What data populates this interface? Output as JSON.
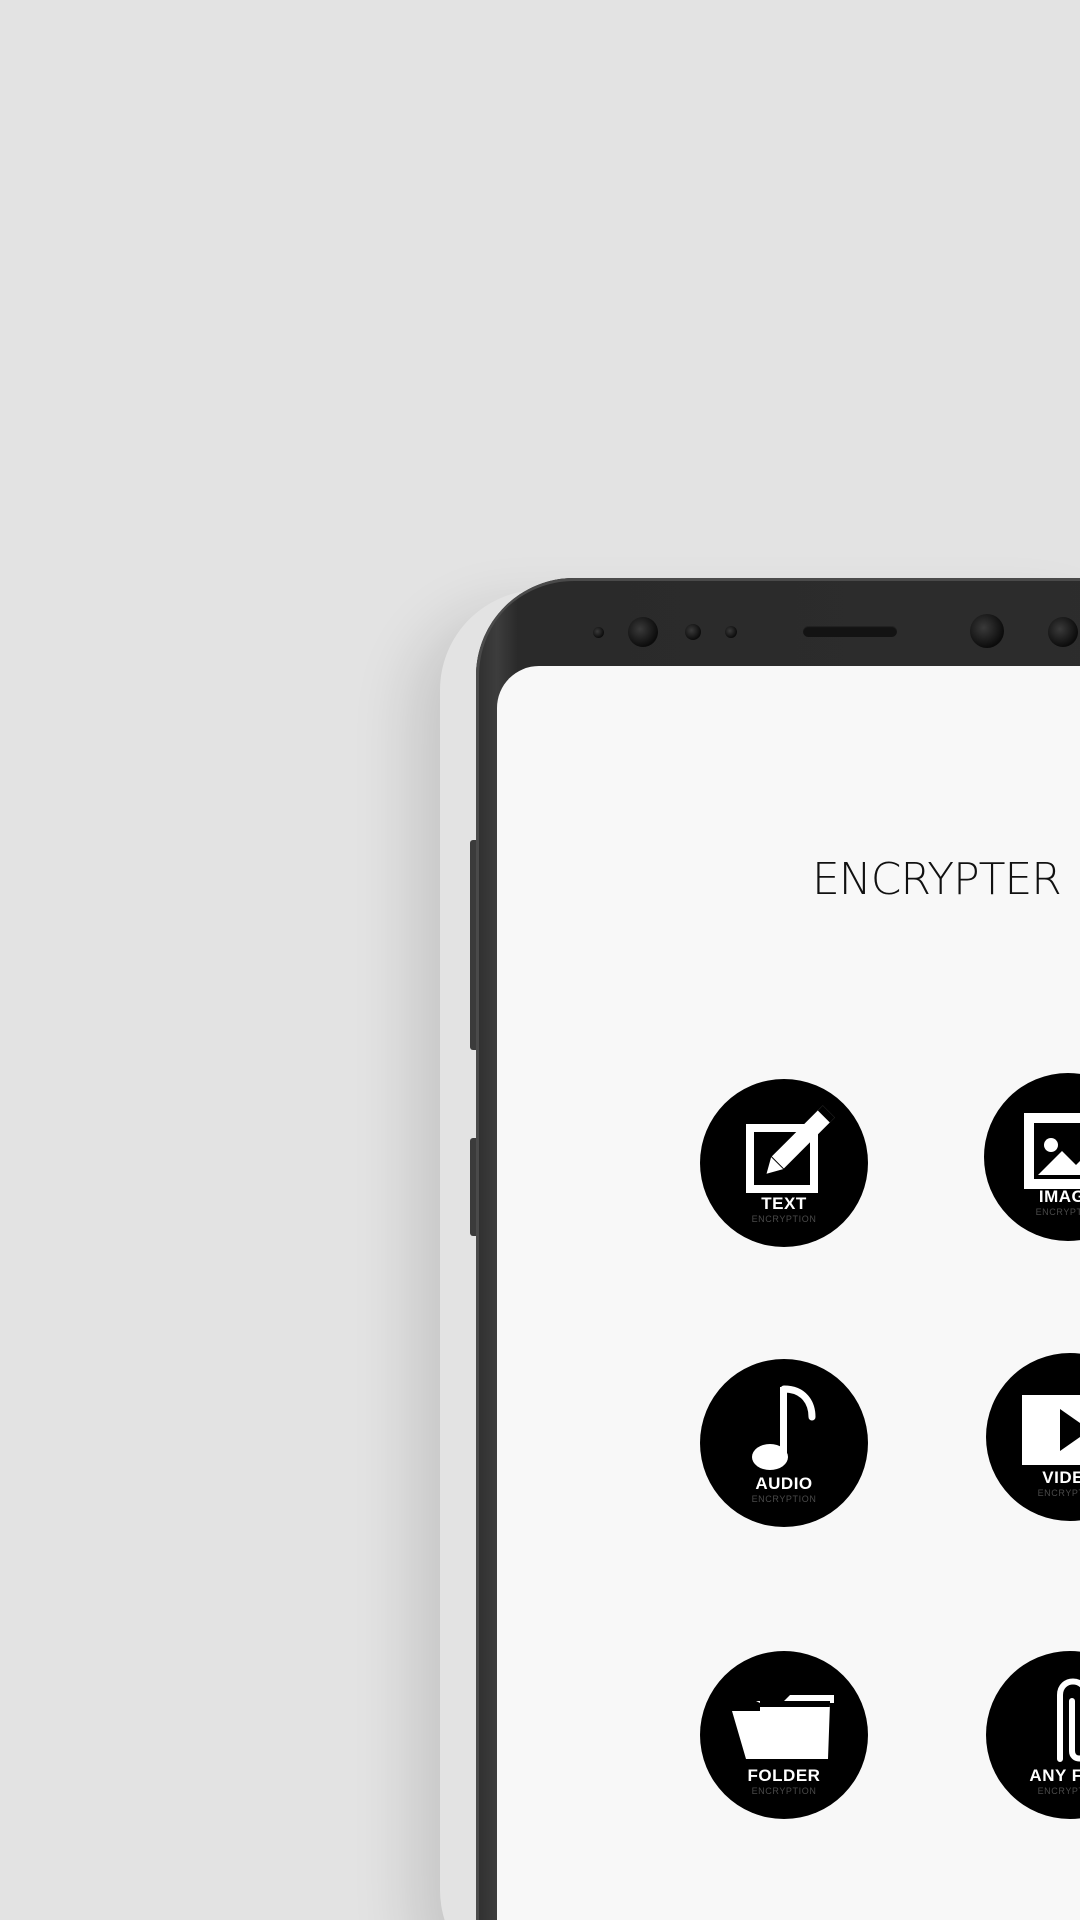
{
  "app": {
    "title": "ENCRYPTER"
  },
  "tiles": [
    {
      "label": "TEXT",
      "sub": "ENCRYPTION",
      "icon": "edit-icon"
    },
    {
      "label": "IMAGE",
      "sub": "ENCRYPTION",
      "icon": "image-icon"
    },
    {
      "label": "AUDIO",
      "sub": "ENCRYPTION",
      "icon": "music-note-icon"
    },
    {
      "label": "VIDEO",
      "sub": "ENCRYPTION",
      "icon": "play-icon"
    },
    {
      "label": "FOLDER",
      "sub": "ENCRYPTION",
      "icon": "folder-icon"
    },
    {
      "label": "ANY FILE",
      "sub": "ENCRYPTION",
      "icon": "paperclip-icon"
    }
  ],
  "colors": {
    "background": "#e3e3e3",
    "screen": "#f8f8f8",
    "tile": "#000000",
    "tile_label": "#ffffff",
    "phone_frame": "#2d2d2d"
  }
}
